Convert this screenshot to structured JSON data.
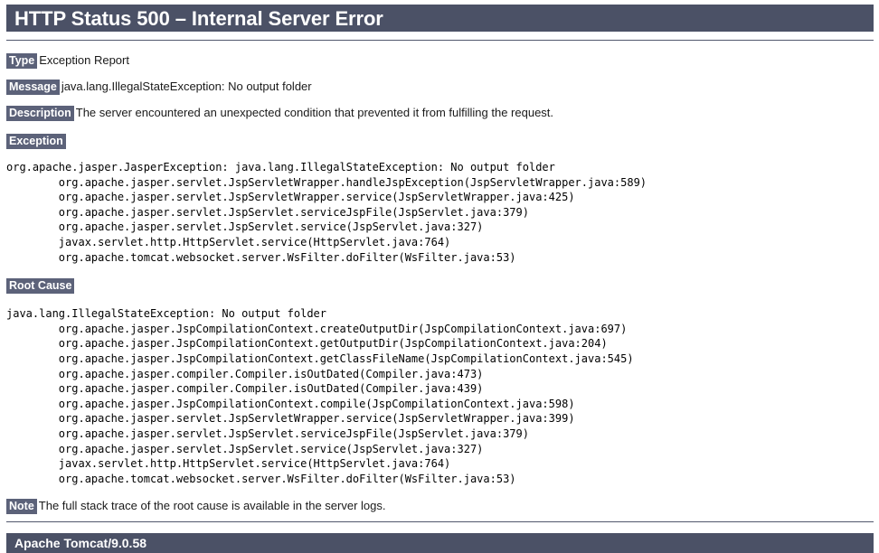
{
  "theme": {
    "bar_background": "#4b5166",
    "tag_background": "#5c6279",
    "bar_text": "#ffffff",
    "rule_color": "#51576d",
    "body_text": "#1a1a1a",
    "page_background": "#ffffff"
  },
  "header": {
    "status_title": "HTTP Status 500 – Internal Server Error"
  },
  "sections": {
    "type": {
      "label": "Type",
      "value": "Exception Report"
    },
    "message": {
      "label": "Message",
      "value": "java.lang.IllegalStateException: No output folder"
    },
    "description": {
      "label": "Description",
      "value": "The server encountered an unexpected condition that prevented it from fulfilling the request."
    },
    "exception": {
      "label": "Exception",
      "trace": "org.apache.jasper.JasperException: java.lang.IllegalStateException: No output folder\n\torg.apache.jasper.servlet.JspServletWrapper.handleJspException(JspServletWrapper.java:589)\n\torg.apache.jasper.servlet.JspServletWrapper.service(JspServletWrapper.java:425)\n\torg.apache.jasper.servlet.JspServlet.serviceJspFile(JspServlet.java:379)\n\torg.apache.jasper.servlet.JspServlet.service(JspServlet.java:327)\n\tjavax.servlet.http.HttpServlet.service(HttpServlet.java:764)\n\torg.apache.tomcat.websocket.server.WsFilter.doFilter(WsFilter.java:53)"
    },
    "root_cause": {
      "label": "Root Cause",
      "trace": "java.lang.IllegalStateException: No output folder\n\torg.apache.jasper.JspCompilationContext.createOutputDir(JspCompilationContext.java:697)\n\torg.apache.jasper.JspCompilationContext.getOutputDir(JspCompilationContext.java:204)\n\torg.apache.jasper.JspCompilationContext.getClassFileName(JspCompilationContext.java:545)\n\torg.apache.jasper.compiler.Compiler.isOutDated(Compiler.java:473)\n\torg.apache.jasper.compiler.Compiler.isOutDated(Compiler.java:439)\n\torg.apache.jasper.JspCompilationContext.compile(JspCompilationContext.java:598)\n\torg.apache.jasper.servlet.JspServletWrapper.service(JspServletWrapper.java:399)\n\torg.apache.jasper.servlet.JspServlet.serviceJspFile(JspServlet.java:379)\n\torg.apache.jasper.servlet.JspServlet.service(JspServlet.java:327)\n\tjavax.servlet.http.HttpServlet.service(HttpServlet.java:764)\n\torg.apache.tomcat.websocket.server.WsFilter.doFilter(WsFilter.java:53)"
    },
    "note": {
      "label": "Note",
      "value": "The full stack trace of the root cause is available in the server logs."
    }
  },
  "footer": {
    "server_signature": "Apache Tomcat/9.0.58"
  }
}
